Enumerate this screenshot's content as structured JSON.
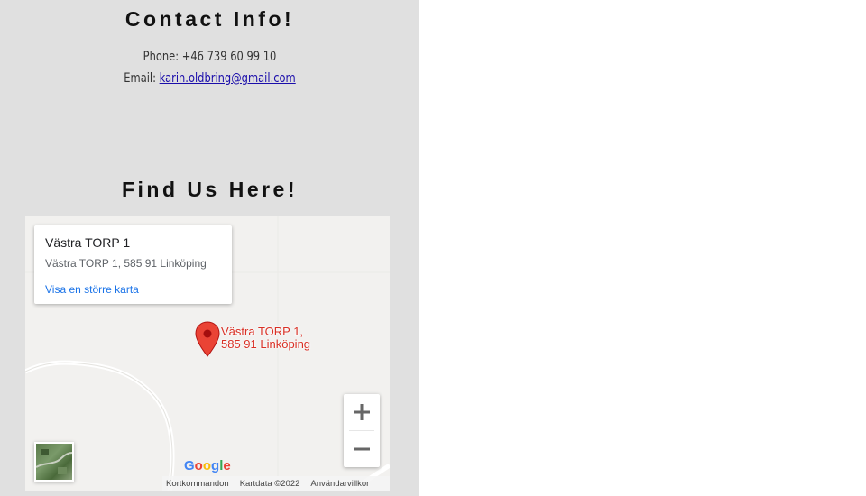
{
  "contact": {
    "title": "Contact Info!",
    "phone_text": "Phone: +46 739 60 99 10",
    "email_prefix": "Email: ",
    "email_link": "karin.oldbring@gmail.com"
  },
  "find": {
    "title": "Find Us Here!"
  },
  "map": {
    "info_card": {
      "title": "Västra TORP 1",
      "address": "Västra TORP 1, 585 91 Linköping",
      "link": "Visa en större karta"
    },
    "pin_label_line1": "Västra TORP 1,",
    "pin_label_line2": "585 91 Linköping",
    "logo": {
      "letters": [
        "G",
        "o",
        "o",
        "g",
        "l",
        "e"
      ],
      "colors": [
        "#4285f4",
        "#ea4335",
        "#fbbc05",
        "#4285f4",
        "#34a853",
        "#ea4335"
      ]
    },
    "footer": {
      "shortcuts": "Kortkommandon",
      "map_data": "Kartdata ©2022",
      "terms": "Användarvillkor"
    },
    "icons": {
      "zoom_in": "plus-icon",
      "zoom_out": "minus-icon",
      "pin": "map-pin-icon",
      "layer": "satellite-layer-icon"
    },
    "colors": {
      "pin": "#ea4335",
      "link": "#1a73e8",
      "map_bg": "#f2f1ef"
    }
  }
}
